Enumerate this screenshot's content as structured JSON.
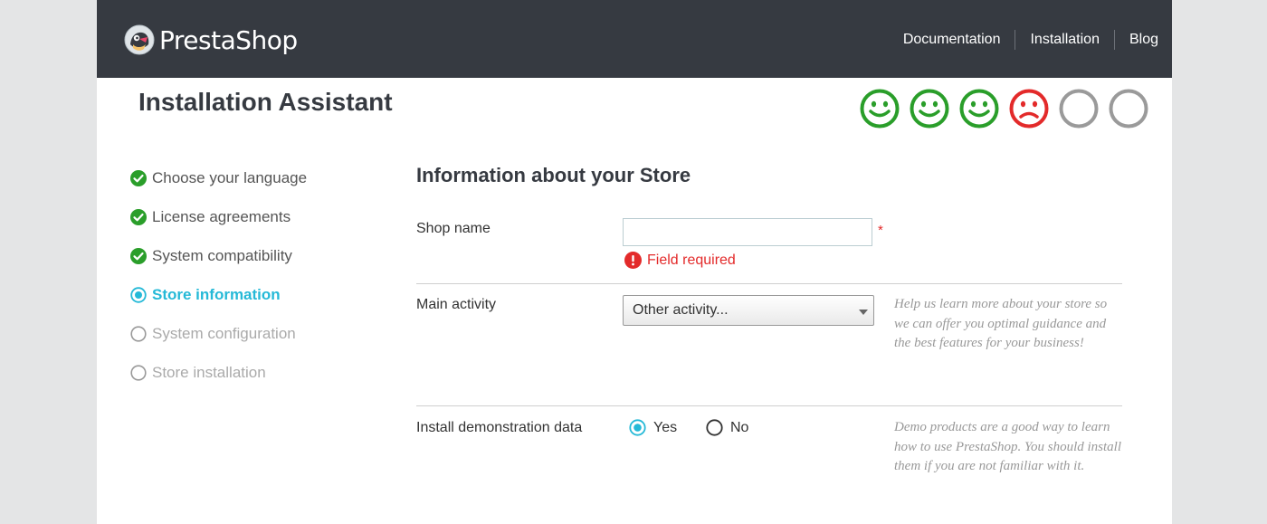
{
  "header": {
    "brand": "PrestaShop",
    "nav": [
      "Documentation",
      "Installation",
      "Blog"
    ]
  },
  "page_title": "Installation Assistant",
  "progress_faces": [
    {
      "mood": "happy",
      "color": "#2eacce"
    },
    {
      "mood": "happy",
      "color": "#2eacce"
    },
    {
      "mood": "happy",
      "color": "#2eacce"
    },
    {
      "mood": "sad",
      "color": "#e32a2a"
    },
    {
      "mood": "empty",
      "color": "#999999"
    },
    {
      "mood": "empty",
      "color": "#999999"
    }
  ],
  "steps": [
    {
      "label": "Choose your language",
      "state": "done"
    },
    {
      "label": "License agreements",
      "state": "done"
    },
    {
      "label": "System compatibility",
      "state": "done"
    },
    {
      "label": "Store information",
      "state": "current"
    },
    {
      "label": "System configuration",
      "state": "todo"
    },
    {
      "label": "Store installation",
      "state": "todo"
    }
  ],
  "form": {
    "section_title": "Information about your Store",
    "shop_name": {
      "label": "Shop name",
      "value": "",
      "required_mark": "*",
      "error": "Field required"
    },
    "main_activity": {
      "label": "Main activity",
      "selected": "Other activity...",
      "help": "Help us learn more about your store so we can offer you optimal guidance and the best features for your business!"
    },
    "demo_data": {
      "label": "Install demonstration data",
      "options": [
        "Yes",
        "No"
      ],
      "selected": "Yes",
      "help": "Demo products are a good way to learn how to use PrestaShop. You should install them if you are not familiar with it."
    }
  },
  "colors": {
    "header_bg": "#363a41",
    "accent": "#25b9d7",
    "success": "#2a9e2a",
    "error": "#e32a2a"
  }
}
